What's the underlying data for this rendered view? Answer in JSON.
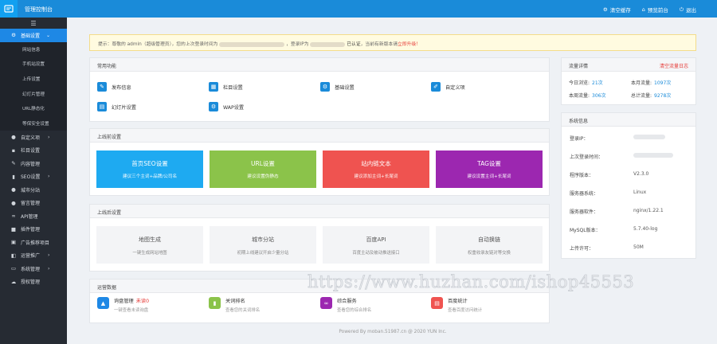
{
  "header": {
    "title": "管理控制台",
    "actions": [
      {
        "label": "清空缓存",
        "icon": "gear-icon"
      },
      {
        "label": "预览前台",
        "icon": "home-icon"
      },
      {
        "label": "退出",
        "icon": "power-icon"
      }
    ]
  },
  "sidebar": {
    "toggle_icon": "menu-icon",
    "active": {
      "label": "基础设置",
      "icon": "gear-icon"
    },
    "subitems": [
      "网站信息",
      "手机站设置",
      "上传设置",
      "幻灯片管理",
      "URL静态化",
      "等保安全设置"
    ],
    "items": [
      {
        "label": "自定义项",
        "icon": "tag-icon",
        "has_sub": true
      },
      {
        "label": "栏目设置",
        "icon": "folder-icon",
        "has_sub": false
      },
      {
        "label": "内容管理",
        "icon": "edit-icon",
        "has_sub": false
      },
      {
        "label": "SEO设置",
        "icon": "chart-icon",
        "has_sub": true
      },
      {
        "label": "城市分站",
        "icon": "globe-icon",
        "has_sub": false
      },
      {
        "label": "留言管理",
        "icon": "comment-icon",
        "has_sub": false
      },
      {
        "label": "API管理",
        "icon": "link-icon",
        "has_sub": false
      },
      {
        "label": "插件管理",
        "icon": "puzzle-icon",
        "has_sub": false
      },
      {
        "label": "广告推荐项目",
        "icon": "ad-icon",
        "has_sub": false
      },
      {
        "label": "运营推广",
        "icon": "bullhorn-icon",
        "has_sub": true
      },
      {
        "label": "系统管理",
        "icon": "monitor-icon",
        "has_sub": true
      },
      {
        "label": "授权管理",
        "icon": "cloud-icon",
        "has_sub": false
      }
    ]
  },
  "notice": {
    "prefix": "提示：尊敬的 admin（超级管理员），您的上次登录时间为",
    "middle": "，登录IP为",
    "auth": "已认证",
    "upgrade_text": "，当前有新版本请",
    "upgrade_link": "立即升级！"
  },
  "quick": {
    "title": "常用功能",
    "items": [
      {
        "label": "发布信息",
        "icon": "publish-icon"
      },
      {
        "label": "栏目设置",
        "icon": "columns-icon"
      },
      {
        "label": "基础设置",
        "icon": "gear-icon"
      },
      {
        "label": "自定义项",
        "icon": "custom-icon"
      },
      {
        "label": "幻灯片设置",
        "icon": "slides-icon"
      },
      {
        "label": "WAP设置",
        "icon": "mobile-icon"
      }
    ]
  },
  "seo": {
    "title": "上线前设置",
    "cards": [
      {
        "title": "首页SEO设置",
        "sub": "建议三个主词+品牌/公司名",
        "color": "#1eaaf1"
      },
      {
        "title": "URL设置",
        "sub": "建议设置伪静态",
        "color": "#8bc34a"
      },
      {
        "title": "站内链文本",
        "sub": "建议添加主词+长尾词",
        "color": "#ef5350"
      },
      {
        "title": "TAG设置",
        "sub": "建议设置主词+长尾词",
        "color": "#9c27b0"
      }
    ]
  },
  "tools": {
    "title": "上线后设置",
    "cards": [
      {
        "title": "地图生成",
        "sub": "一键生成网站地图"
      },
      {
        "title": "城市分站",
        "sub": "初期上线建议开启少量分站"
      },
      {
        "title": "百度API",
        "sub": "百度主动及被动推送接口"
      },
      {
        "title": "自动换链",
        "sub": "权重收录友链对等交换"
      }
    ]
  },
  "ops": {
    "title": "运营数据",
    "items": [
      {
        "title": "询盘管理",
        "badge": "未读0",
        "sub": "一键查看未读询盘",
        "icon": "inbox-icon",
        "color": "#1e88e5"
      },
      {
        "title": "关词排名",
        "badge": "",
        "sub": "查看您的关词排名",
        "icon": "bar-chart-icon",
        "color": "#8bc34a"
      },
      {
        "title": "综合服务",
        "badge": "",
        "sub": "查看您的综合排名",
        "icon": "link-icon",
        "color": "#9c27b0"
      },
      {
        "title": "百度统计",
        "badge": "",
        "sub": "查看百度访问统计",
        "icon": "report-icon",
        "color": "#ef5350"
      }
    ]
  },
  "traffic": {
    "title": "流量详情",
    "clear_label": "清空流量日志",
    "today_label": "今日浏览:",
    "today_value": "21次",
    "month_label": "本月流量:",
    "month_value": "1097次",
    "week_label": "本周流量:",
    "week_value": "306次",
    "total_label": "总计流量:",
    "total_value": "9278次"
  },
  "system": {
    "title": "系统信息",
    "rows": [
      {
        "label": "登录IP：",
        "value": ""
      },
      {
        "label": "上次登录时间：",
        "value": ""
      },
      {
        "label": "程序版本：",
        "value": "V2.3.0"
      },
      {
        "label": "服务器系统：",
        "value": "Linux"
      },
      {
        "label": "服务器软件：",
        "value": "nginx/1.22.1"
      },
      {
        "label": "MySQL版本：",
        "value": "5.7.40-log"
      },
      {
        "label": "上传许可：",
        "value": "50M"
      }
    ]
  },
  "footer": {
    "text": "Powered By moban.51987.cn @ 2020 YUN Inc."
  },
  "watermark": {
    "text": "https://www.huzhan.com/ishop45553"
  }
}
